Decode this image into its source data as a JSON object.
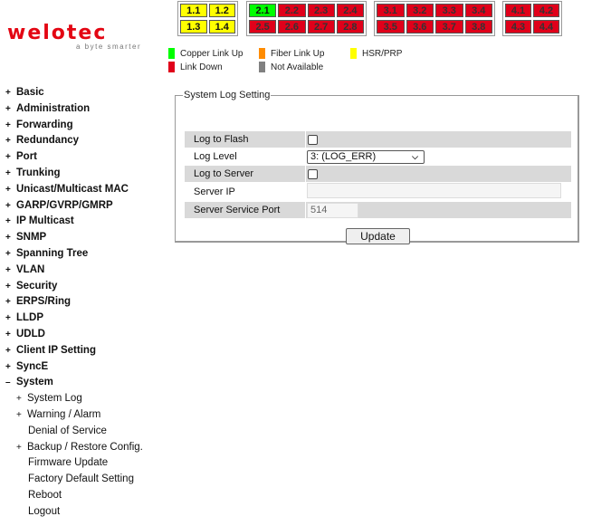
{
  "logo": {
    "brand": "welotec",
    "tagline": "a byte smarter"
  },
  "port_groups": [
    {
      "name": "group-1",
      "ports": [
        {
          "label": "1.1",
          "status": "yellow"
        },
        {
          "label": "1.2",
          "status": "yellow"
        },
        {
          "label": "1.3",
          "status": "yellow"
        },
        {
          "label": "1.4",
          "status": "yellow"
        }
      ]
    },
    {
      "name": "group-2",
      "ports": [
        {
          "label": "2.1",
          "status": "green"
        },
        {
          "label": "2.2",
          "status": "red"
        },
        {
          "label": "2.3",
          "status": "red"
        },
        {
          "label": "2.4",
          "status": "red"
        },
        {
          "label": "2.5",
          "status": "red"
        },
        {
          "label": "2.6",
          "status": "red"
        },
        {
          "label": "2.7",
          "status": "red"
        },
        {
          "label": "2.8",
          "status": "red"
        }
      ]
    },
    {
      "name": "group-3",
      "ports": [
        {
          "label": "3.1",
          "status": "red"
        },
        {
          "label": "3.2",
          "status": "red"
        },
        {
          "label": "3.3",
          "status": "red"
        },
        {
          "label": "3.4",
          "status": "red"
        },
        {
          "label": "3.5",
          "status": "red"
        },
        {
          "label": "3.6",
          "status": "red"
        },
        {
          "label": "3.7",
          "status": "red"
        },
        {
          "label": "3.8",
          "status": "red"
        }
      ]
    },
    {
      "name": "group-4",
      "ports": [
        {
          "label": "4.1",
          "status": "red"
        },
        {
          "label": "4.2",
          "status": "red"
        },
        {
          "label": "4.3",
          "status": "red"
        },
        {
          "label": "4.4",
          "status": "red"
        }
      ]
    }
  ],
  "legend": {
    "copper_link_up": {
      "label": "Copper Link Up",
      "color": "#00ff00"
    },
    "fiber_link_up": {
      "label": "Fiber Link Up",
      "color": "#ff8c00"
    },
    "hsr_prp": {
      "label": "HSR/PRP",
      "color": "#ffff00"
    },
    "link_down": {
      "label": "Link Down",
      "color": "#e0001a"
    },
    "not_available": {
      "label": "Not Available",
      "color": "#808080"
    }
  },
  "nav": {
    "items": [
      {
        "label": "Basic",
        "expander": "+"
      },
      {
        "label": "Administration",
        "expander": "+"
      },
      {
        "label": "Forwarding",
        "expander": "+"
      },
      {
        "label": "Redundancy",
        "expander": "+"
      },
      {
        "label": "Port",
        "expander": "+"
      },
      {
        "label": "Trunking",
        "expander": "+"
      },
      {
        "label": "Unicast/Multicast MAC",
        "expander": "+"
      },
      {
        "label": "GARP/GVRP/GMRP",
        "expander": "+"
      },
      {
        "label": "IP Multicast",
        "expander": "+"
      },
      {
        "label": "SNMP",
        "expander": "+"
      },
      {
        "label": "Spanning Tree",
        "expander": "+"
      },
      {
        "label": "VLAN",
        "expander": "+"
      },
      {
        "label": "Security",
        "expander": "+"
      },
      {
        "label": "ERPS/Ring",
        "expander": "+"
      },
      {
        "label": "LLDP",
        "expander": "+"
      },
      {
        "label": "UDLD",
        "expander": "+"
      },
      {
        "label": "Client IP Setting",
        "expander": "+"
      },
      {
        "label": "SyncE",
        "expander": "+"
      },
      {
        "label": "System",
        "expander": "–"
      }
    ],
    "system_children": [
      {
        "label": "System Log",
        "expander": "+"
      },
      {
        "label": "Warning / Alarm",
        "expander": "+"
      },
      {
        "label": "Denial of Service",
        "expander": ""
      },
      {
        "label": "Backup / Restore Config.",
        "expander": "+"
      },
      {
        "label": "Firmware Update",
        "expander": ""
      },
      {
        "label": "Factory Default Setting",
        "expander": ""
      },
      {
        "label": "Reboot",
        "expander": ""
      },
      {
        "label": "Logout",
        "expander": ""
      }
    ]
  },
  "form": {
    "title": "System Log Setting",
    "log_to_flash": {
      "label": "Log to Flash",
      "checked": false
    },
    "log_level": {
      "label": "Log Level",
      "value": "3: (LOG_ERR)"
    },
    "log_to_server": {
      "label": "Log to Server",
      "checked": false
    },
    "server_ip": {
      "label": "Server IP",
      "value": ""
    },
    "server_port": {
      "label": "Server Service Port",
      "value": "514"
    },
    "update_label": "Update"
  }
}
